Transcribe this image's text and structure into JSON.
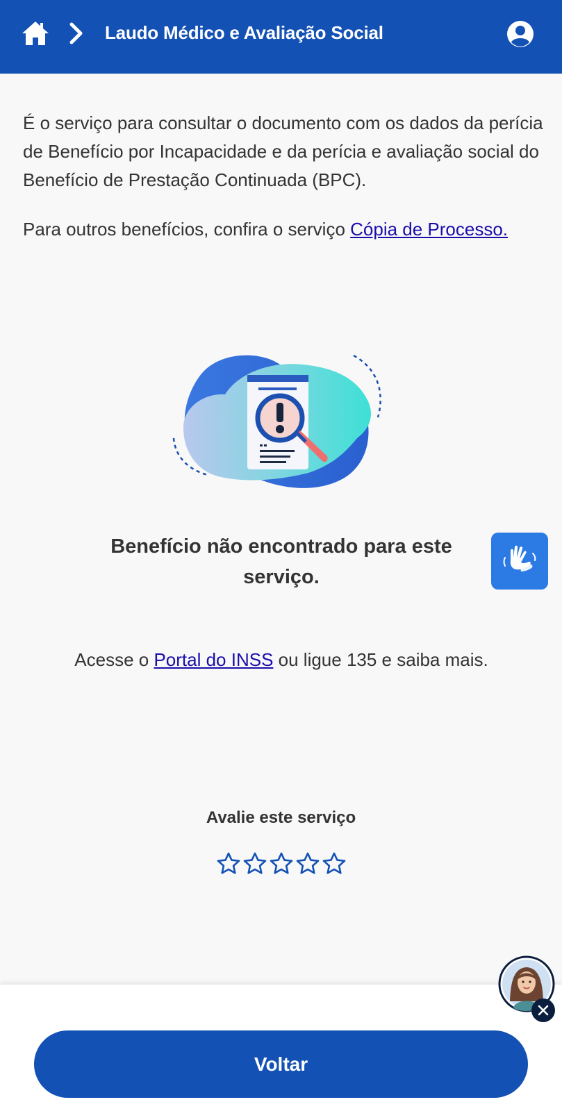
{
  "header": {
    "title": "Laudo Médico e Avaliação Social",
    "icons": [
      "home-icon",
      "chevron-right-icon",
      "user-account-icon"
    ],
    "color": "#1351b4"
  },
  "intro": {
    "paragraph1": "É o serviço para consultar o documento com os dados da perícia de Benefício por Incapacidade e da perícia e avaliação social do Benefício de Prestação Continuada (BPC).",
    "paragraph2_prefix": "Para outros benefícios, confira o serviço ",
    "paragraph2_link": "Cópia de Processo."
  },
  "result": {
    "message": "Benefício não encontrado para este serviço.",
    "access_prefix": "Acesse o ",
    "access_link": "Portal do INSS",
    "access_suffix": " ou ligue 135 e saiba mais."
  },
  "rating": {
    "label": "Avalie este serviço",
    "max_stars": 5,
    "current": 0
  },
  "footer": {
    "back_label": "Voltar"
  },
  "colors": {
    "primary": "#1351b4",
    "libras_button": "#2c7be5",
    "link": "#1a0dab",
    "text": "#333333",
    "background": "#f8f8f8"
  }
}
